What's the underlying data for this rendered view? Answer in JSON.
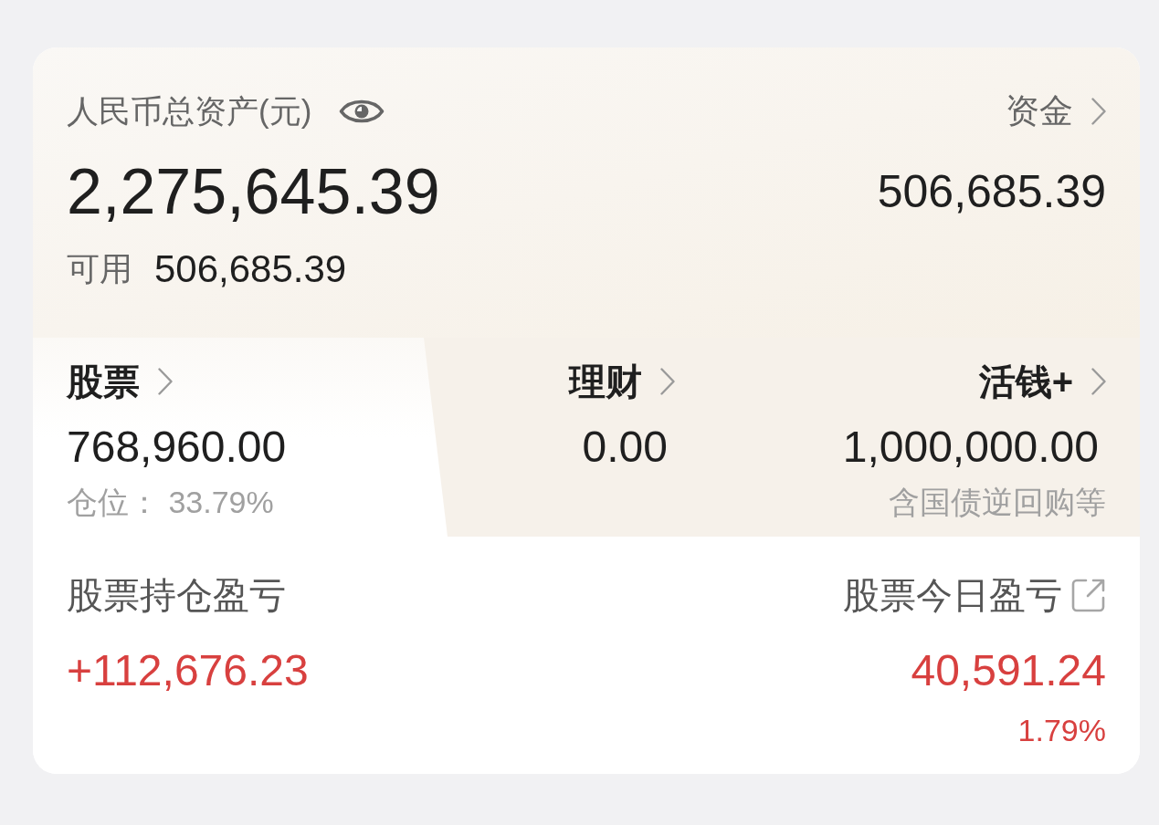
{
  "total_assets": {
    "label": "人民币总资产(元)",
    "amount": "2,275,645.39",
    "available_label": "可用",
    "available_amount": "506,685.39"
  },
  "funds": {
    "label": "资金",
    "amount": "506,685.39"
  },
  "tabs": [
    {
      "label": "股票",
      "amount": "768,960.00",
      "note": "仓位： 33.79%",
      "selected": true
    },
    {
      "label": "理财",
      "amount": "0.00",
      "selected": false
    },
    {
      "label": "活钱+",
      "amount": "1,000,000.00",
      "note": "含国债逆回购等",
      "selected": false
    }
  ],
  "holding_pnl": {
    "label": "股票持仓盈亏",
    "amount": "+112,676.23"
  },
  "today_pnl": {
    "label": "股票今日盈亏",
    "amount": "40,591.24",
    "percent": "1.79%"
  }
}
